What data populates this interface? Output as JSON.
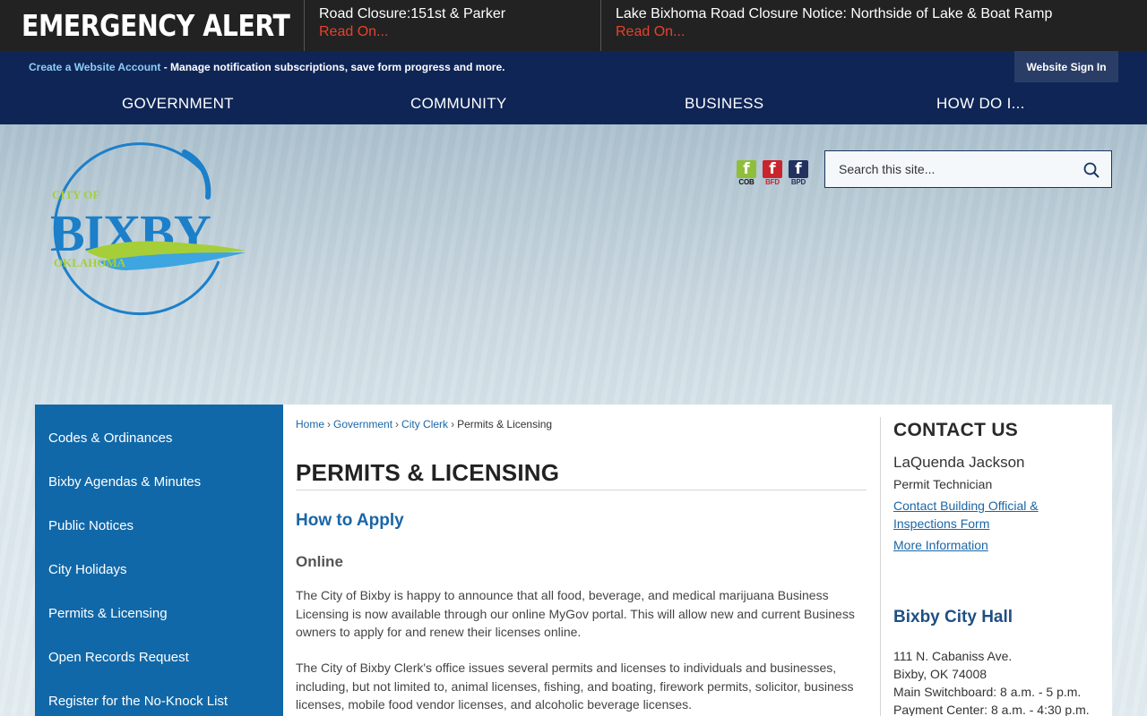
{
  "alert_bar": {
    "title": "EMERGENCY ALERT",
    "items": [
      {
        "title": "Road Closure:151st & Parker",
        "link": "Read On..."
      },
      {
        "title": "Lake Bixhoma Road Closure Notice: Northside of Lake & Boat Ramp",
        "link": "Read On..."
      }
    ]
  },
  "account_bar": {
    "create_link": "Create a Website Account",
    "text": " - Manage notification subscriptions, save form progress and more.",
    "signin": "Website Sign In"
  },
  "main_nav": [
    "GOVERNMENT",
    "COMMUNITY",
    "BUSINESS",
    "HOW DO I..."
  ],
  "logo": {
    "line1": "CITY OF",
    "line2": "BIXBY",
    "line3": "OKLAHOMA"
  },
  "social": [
    {
      "label": "COB",
      "glyph": "f",
      "color": "#8fbf3a",
      "label_color": "#111"
    },
    {
      "label": "BFD",
      "glyph": "f",
      "color": "#c9252c",
      "label_color": "#c9252c"
    },
    {
      "label": "BPD",
      "glyph": "f",
      "color": "#22325f",
      "label_color": "#22325f"
    }
  ],
  "search": {
    "placeholder": "Search this site..."
  },
  "sidebar": [
    "Codes & Ordinances",
    "Bixby Agendas & Minutes",
    "Public Notices",
    "City Holidays",
    "Permits & Licensing",
    "Open Records Request",
    "Register for the No-Knock List"
  ],
  "breadcrumb": {
    "home": "Home",
    "gov": "Government",
    "clerk": "City Clerk",
    "current": "Permits & Licensing",
    "sep": "›"
  },
  "main": {
    "title": "PERMITS & LICENSING",
    "h2": "How to Apply",
    "h3": "Online",
    "p1": "The City of Bixby is happy to announce that all food, beverage, and medical marijuana Business Licensing is now available through our online MyGov portal. This will allow new and current Business owners to apply for and renew their licenses online.",
    "p2": "The City of Bixby Clerk's office issues several permits and licenses to individuals and businesses, including, but not limited to, animal licenses, fishing, and boating, firework permits, solicitor, business licenses, mobile food vendor licenses, and alcoholic beverage licenses."
  },
  "contact": {
    "heading": "CONTACT US",
    "name": "LaQuenda Jackson",
    "role": "Permit Technician",
    "link1": "Contact Building Official & Inspections Form",
    "link2": "More Information",
    "hall_heading": "Bixby City Hall",
    "address1": "111 N. Cabaniss Ave.",
    "address2": "Bixby, OK 74008",
    "hours1": "Main Switchboard: 8 a.m. - 5 p.m.",
    "hours2": "Payment Center: 8 a.m. - 4:30 p.m."
  }
}
